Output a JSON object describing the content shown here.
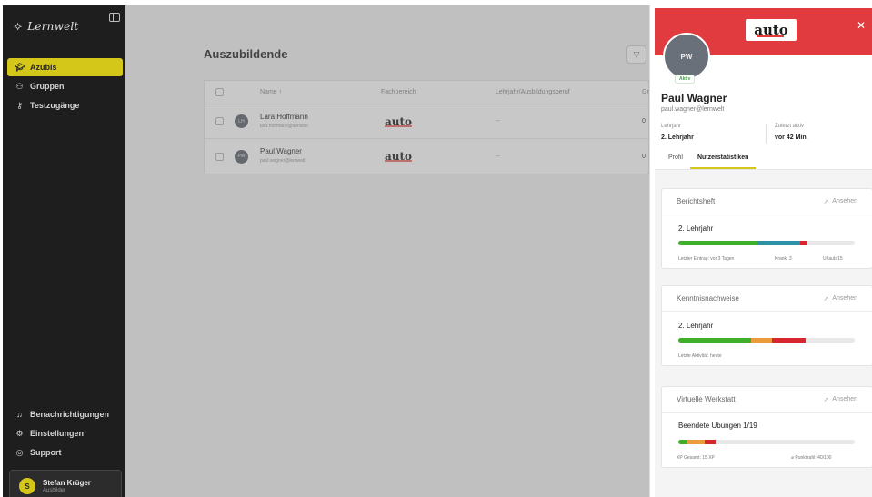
{
  "sidebar": {
    "brand": "Lernwelt",
    "nav": [
      {
        "label": "Azubis",
        "icon": "graduation-cap-icon",
        "active": true
      },
      {
        "label": "Gruppen",
        "icon": "users-icon",
        "active": false
      },
      {
        "label": "Testzugänge",
        "icon": "key-icon",
        "active": false
      }
    ],
    "bottom_nav": [
      {
        "label": "Benachrichtigungen",
        "icon": "bell-icon"
      },
      {
        "label": "Einstellungen",
        "icon": "gear-icon"
      },
      {
        "label": "Support",
        "icon": "lifebuoy-icon"
      }
    ],
    "user": {
      "initial": "S",
      "name": "Stefan Krüger",
      "role": "Ausbilder"
    }
  },
  "main": {
    "title": "Auszubildende",
    "table": {
      "headers": {
        "name": "Name ↑",
        "fachbereich": "Fachbereich",
        "lehrjahr": "Lehrjahr/Ausbildungsberuf",
        "g": "Gr"
      },
      "rows": [
        {
          "initials": "LH",
          "name": "Lara Hoffmann",
          "email": "lara.hoffmann@lernwelt",
          "fach_logo": "auto",
          "lehrjahr": "--",
          "g": "0"
        },
        {
          "initials": "PW",
          "name": "Paul Wagner",
          "email": "paul.wagner@lernwelt",
          "fach_logo": "auto",
          "lehrjahr": "--",
          "g": "0"
        }
      ]
    }
  },
  "drawer": {
    "logo": "auto",
    "initials": "PW",
    "status": "Aktiv",
    "name": "Paul Wagner",
    "email": "paul.wagner@lernwelt",
    "lehrjahr_label": "Lehrjahr",
    "lehrjahr_value": "2. Lehrjahr",
    "zuletzt_label": "Zuletzt aktiv",
    "zuletzt_value": "vor 42 Min.",
    "tabs": [
      "Profil",
      "Nutzerstatistiken"
    ],
    "active_tab": "Nutzerstatistiken",
    "link_label": "Ansehen",
    "cards": [
      {
        "title": "Berichtsheft",
        "subtitle": "2. Lehrjahr",
        "segments": [
          {
            "color": "#3fae2a",
            "share": 0.45
          },
          {
            "color": "#2e8fa8",
            "share": 0.24
          },
          {
            "color": "#d8262e",
            "share": 0.04
          }
        ],
        "footer": [
          "Letzter Eintrag: vor 3 Tagen",
          "Krank: 3",
          "Urlaub:15"
        ]
      },
      {
        "title": "Kenntnisnachweise",
        "subtitle": "2. Lehrjahr",
        "segments": [
          {
            "color": "#3fae2a",
            "share": 0.41
          },
          {
            "color": "#eb9a3c",
            "share": 0.12
          },
          {
            "color": "#d8262e",
            "share": 0.19
          }
        ],
        "footer": [
          "Letzte Aktivität: heute"
        ]
      },
      {
        "title": "Virtuelle Werkstatt",
        "subtitle": "Beendete Übungen 1/19",
        "segments": [
          {
            "color": "#3fae2a",
            "share": 0.05
          },
          {
            "color": "#eb9a3c",
            "share": 0.1
          },
          {
            "color": "#d8262e",
            "share": 0.06
          }
        ],
        "footer": [
          "XP Gesamt: 15 XP",
          "⌀ Punktzahl: 40/100"
        ]
      }
    ]
  }
}
